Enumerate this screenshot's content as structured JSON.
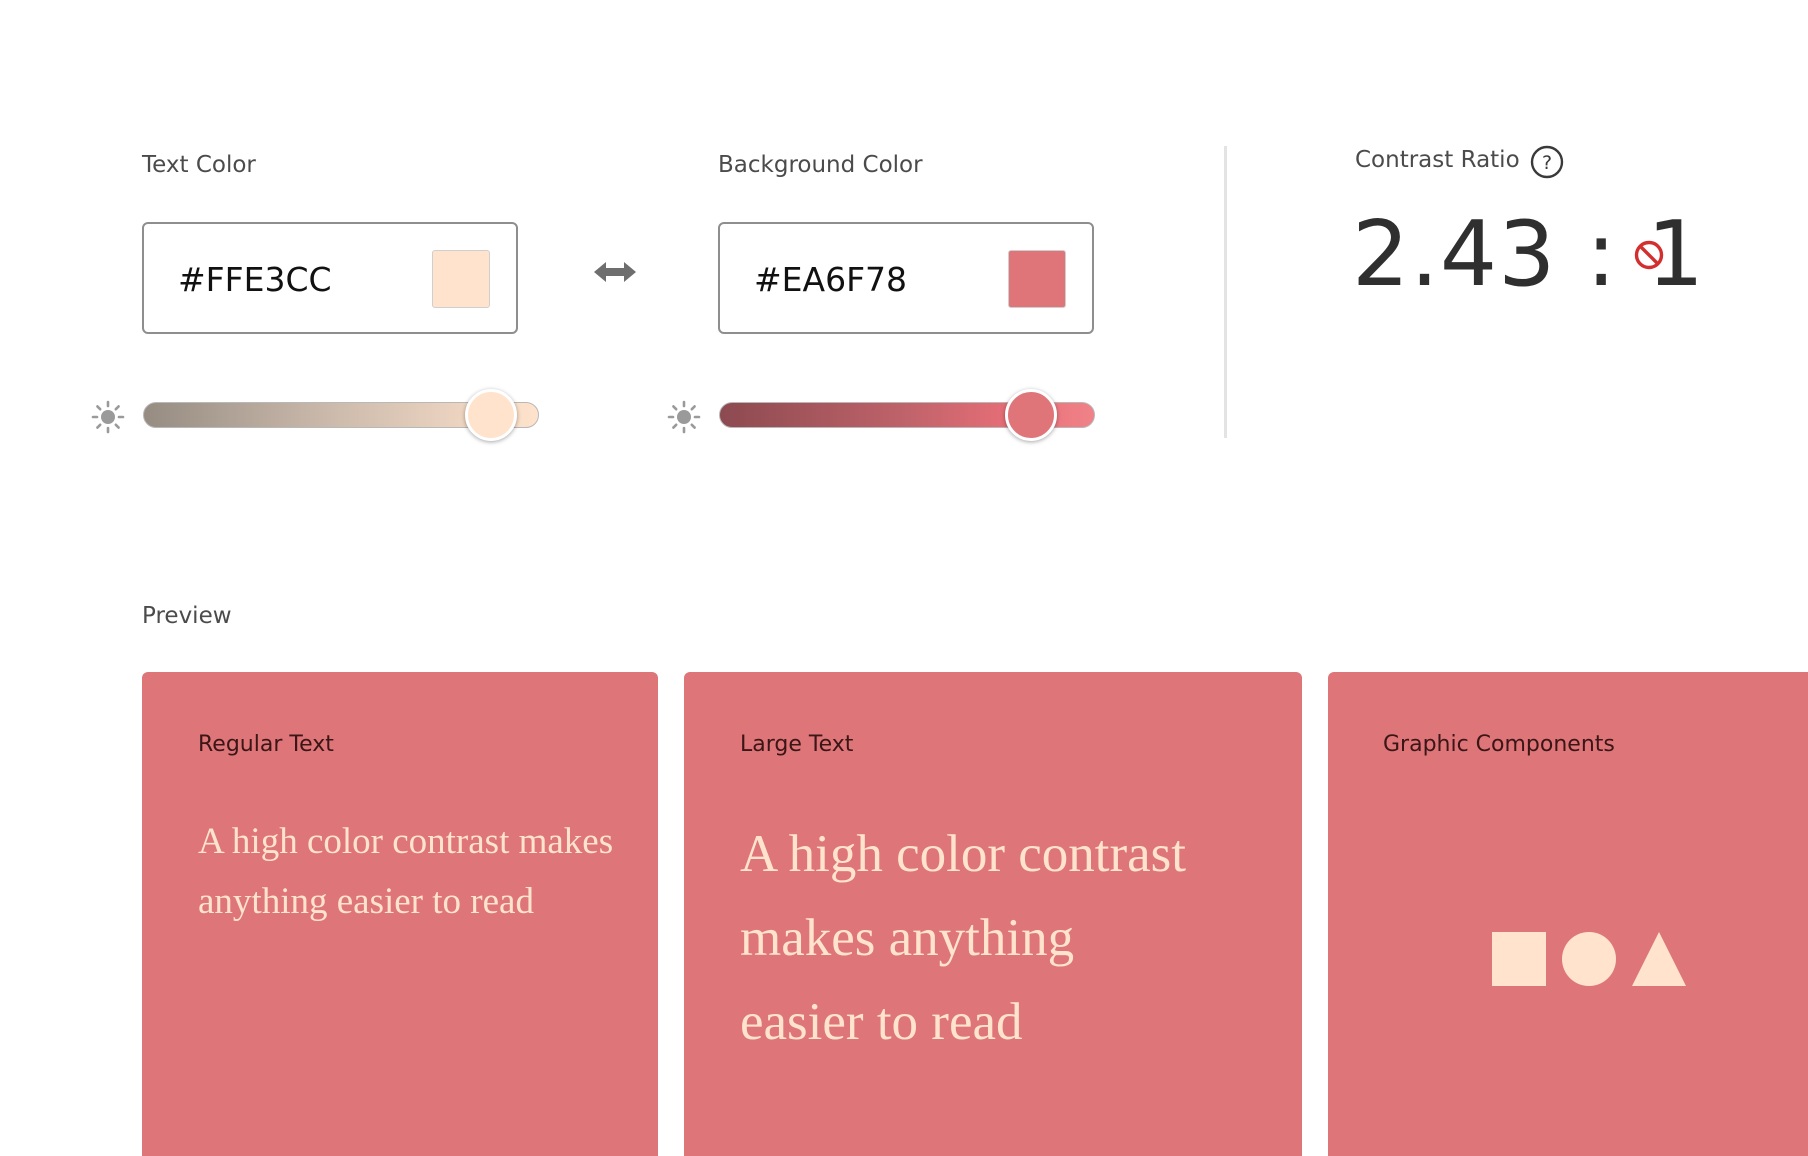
{
  "text_color": {
    "label": "Text Color",
    "value": "#FFE3CC",
    "swatch": "#FFE3CC",
    "brightness_level": 1.0
  },
  "background_color": {
    "label": "Background Color",
    "value": "#EA6F78",
    "swatch": "#DF7479",
    "brightness_level": 0.83
  },
  "swap_icon": "swap-horizontal-icon",
  "brightness_icon": "sun-icon",
  "contrast": {
    "label": "Contrast Ratio",
    "value": "2.43 : 1",
    "status_icon": "fail-icon",
    "status_color": "#D32F2F"
  },
  "preview": {
    "label": "Preview",
    "card_bg": "#DE7579",
    "text_fg": "#FFE3CC",
    "cards": [
      {
        "title": "Regular Text",
        "body": "A high color contrast makes anything easier to read"
      },
      {
        "title": "Large Text",
        "body": "A high color contrast makes anything easier to read"
      },
      {
        "title": "Graphic Components"
      }
    ]
  }
}
